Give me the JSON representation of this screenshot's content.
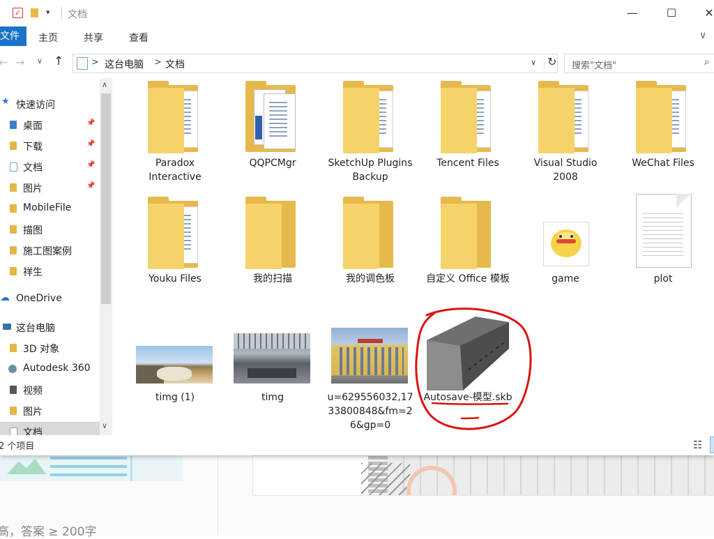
{
  "window": {
    "title": "文档",
    "controls": {
      "minimize": "—",
      "maximize": "☐",
      "close": "✕"
    }
  },
  "quick_access_toolbar": {
    "dropdown_glyph": "▾"
  },
  "ribbon": {
    "file_tab": "文件",
    "tabs": [
      "主页",
      "共享",
      "查看"
    ],
    "expand_glyph": "∨"
  },
  "address": {
    "breadcrumbs": [
      "这台电脑",
      "文档"
    ],
    "separator": ">",
    "search_placeholder": "搜索\"文档\""
  },
  "nav_pane": {
    "items": [
      {
        "label": "快速访问",
        "icon": "star-icon"
      },
      {
        "label": "桌面",
        "icon": "desktop-folder-icon",
        "pinned": true
      },
      {
        "label": "下载",
        "icon": "download-folder-icon",
        "pinned": true
      },
      {
        "label": "文档",
        "icon": "documents-folder-icon",
        "pinned": true
      },
      {
        "label": "图片",
        "icon": "pictures-folder-icon",
        "pinned": true
      },
      {
        "label": "MobileFile",
        "icon": "folder-icon"
      },
      {
        "label": "描图",
        "icon": "folder-icon"
      },
      {
        "label": "施工图案例",
        "icon": "folder-icon"
      },
      {
        "label": "祥生",
        "icon": "folder-icon"
      },
      {
        "label": "OneDrive",
        "icon": "cloud-icon"
      },
      {
        "label": "这台电脑",
        "icon": "computer-icon"
      },
      {
        "label": "3D 对象",
        "icon": "3d-objects-icon"
      },
      {
        "label": "Autodesk 360",
        "icon": "autodesk-360-icon"
      },
      {
        "label": "视频",
        "icon": "videos-folder-icon"
      },
      {
        "label": "图片",
        "icon": "pictures-folder-icon"
      },
      {
        "label": "文档",
        "icon": "documents-folder-icon",
        "selected": true
      }
    ]
  },
  "files": [
    {
      "name": "Paradox Interactive",
      "type": "folder"
    },
    {
      "name": "QQPCMgr",
      "type": "folder-with-docs"
    },
    {
      "name": "SketchUp Plugins Backup",
      "type": "folder"
    },
    {
      "name": "Tencent Files",
      "type": "folder"
    },
    {
      "name": "Visual Studio 2008",
      "type": "folder"
    },
    {
      "name": "WeChat Files",
      "type": "folder"
    },
    {
      "name": "Youku Files",
      "type": "folder"
    },
    {
      "name": "我的扫描",
      "type": "empty-folder"
    },
    {
      "name": "我的调色板",
      "type": "empty-folder"
    },
    {
      "name": "自定义 Office 模板",
      "type": "empty-folder"
    },
    {
      "name": "game",
      "type": "image"
    },
    {
      "name": "plot",
      "type": "document"
    },
    {
      "name": "timg (1)",
      "type": "photo"
    },
    {
      "name": "timg",
      "type": "photo"
    },
    {
      "name": "u=629556032,1733800848&fm=26&gp=0",
      "type": "photo"
    },
    {
      "name": "Autosave-模型.skb",
      "type": "sketchup-backup"
    }
  ],
  "status": {
    "item_count": "2 个项目"
  },
  "background": {
    "text": "高，答案 ≥ 200字"
  },
  "colors": {
    "accent": "#1a73c8",
    "folder": "#f6d36a",
    "annotation": "#d9140e"
  }
}
